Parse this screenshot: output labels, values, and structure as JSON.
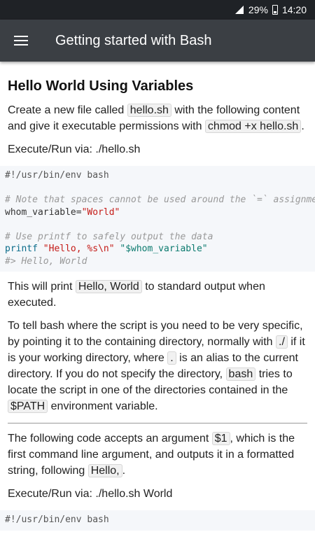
{
  "status": {
    "battery": "29%",
    "time": "14:20"
  },
  "app_bar": {
    "title": "Getting started with Bash"
  },
  "section": {
    "title": "Hello World Using Variables",
    "intro_1": "Create a new file called ",
    "intro_code_1": "hello.sh",
    "intro_2": " with the following content and give it executable permissions with ",
    "intro_code_2": "chmod +x hello.sh",
    "intro_3": ".",
    "execute_1": "Execute/Run via: ./hello.sh",
    "code1": {
      "shebang": "#!/usr/bin/env bash",
      "comment1": "# Note that spaces cannot be used around the `=` assignment operator",
      "var_name": "whom_variable=",
      "var_value": "\"World\"",
      "comment2": "# Use printf to safely output the data",
      "printf_kw": "printf",
      "printf_fmt": "\"Hello, %s\\n\"",
      "printf_arg": "\"$whom_variable\"",
      "output": "#> Hello, World"
    },
    "print_1": "This will print ",
    "print_code": "Hello, World",
    "print_2": " to standard output when executed.",
    "tell_1": "To tell bash where the script is you need to be very specific, by pointing it to the containing directory, normally with ",
    "tell_code_1": "./",
    "tell_2": " if it is your working directory, where ",
    "tell_code_2": ".",
    "tell_3": " is an alias to the current directory. If you do not specify the directory, ",
    "tell_code_3": "bash",
    "tell_4": " tries to locate the script in one of the directories contained in the ",
    "tell_code_4": "$PATH",
    "tell_5": " environment variable.",
    "arg_1": "The following code accepts an argument ",
    "arg_code_1": "$1",
    "arg_2": ", which is the first command line argument, and outputs it in a formatted string, following ",
    "arg_code_2": "Hello,",
    "arg_3": ".",
    "execute_2": "Execute/Run via: ./hello.sh World",
    "code2": {
      "shebang": "#!/usr/bin/env bash"
    }
  }
}
